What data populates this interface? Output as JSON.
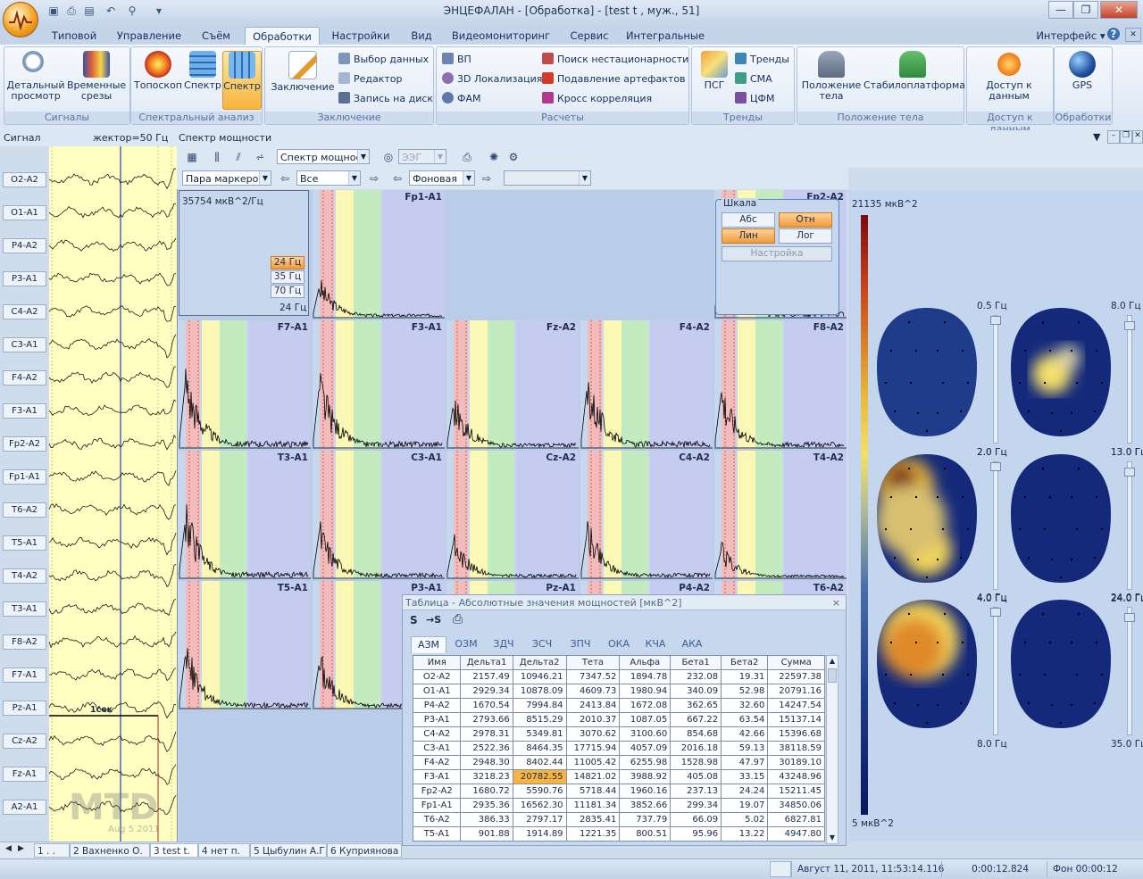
{
  "window": {
    "title": "ЭНЦЕФАЛАН - [Обработка] - [test t , муж., 51]",
    "minimize_glyph": "—",
    "maximize_glyph": "❐",
    "close_glyph": "✕"
  },
  "ribbon_tabs": [
    "Типовой",
    "Управление",
    "Съём",
    "Обработки",
    "Настройки",
    "Вид",
    "Видеомониторинг",
    "Сервис",
    "Интегральные"
  ],
  "ribbon_active_tab": "Обработки",
  "ribbon_right": {
    "interface_label": "Интерфейс",
    "help_glyph": "?"
  },
  "ribbon": {
    "signals": {
      "label": "Сигналы",
      "detail": "Детальный просмотр",
      "time_slices": "Временные срезы"
    },
    "spectral": {
      "label": "Спектральный анализ",
      "toposcop": "Топоскоп",
      "spectrum": "Спектр",
      "spectrum_active": "Спектр"
    },
    "conclusion": {
      "label": "Заключение",
      "conclusion": "Заключение",
      "select_data": "Выбор данных",
      "editor": "Редактор",
      "write_disk": "Запись на диск"
    },
    "calc": {
      "label": "Расчеты",
      "vp": "ВП",
      "loc3d": "3D Локализация",
      "fam": "ФАМ",
      "nonstat": "Поиск нестационарности",
      "artifact": "Подавление артефактов",
      "cross": "Кросс корреляция"
    },
    "trends": {
      "label": "Тренды",
      "psg": "ПСГ",
      "trends": "Тренды",
      "sma": "СМА",
      "cfm": "ЦФМ"
    },
    "body_pos": {
      "label": "Положение тела",
      "position": "Положение тела",
      "stabilo": "Стабилоплатформа"
    },
    "data_access": {
      "label": "Доступ к данным",
      "access": "Доступ к данным"
    },
    "processing": {
      "label": "Обработки",
      "gps": "GPS"
    }
  },
  "left_panel": {
    "title": "Сигнал",
    "filter": "жектор=50 Гц",
    "channels": [
      "O2-A2",
      "O1-A1",
      "P4-A2",
      "P3-A1",
      "C4-A2",
      "C3-A1",
      "F4-A2",
      "F3-A1",
      "Fp2-A2",
      "Fp1-A1",
      "T6-A2",
      "T5-A1",
      "T4-A2",
      "T3-A1",
      "F8-A2",
      "F7-A1",
      "Pz-A1",
      "Cz-A2",
      "Fz-A1",
      "A2-A1"
    ],
    "scale_label": "1сек",
    "watermark": "MTD",
    "watermark_date": "Aug  5 2011"
  },
  "spectrum_panel": {
    "title": "Спектр мощности",
    "mode_combo": "Спектр мощнос",
    "eeg_combo": "ЭЭГ",
    "marker_combo": "Пара маркеров",
    "all_combo": "Все",
    "background_combo": "Фоновая "
  },
  "spectrum_info": {
    "max_value": "35754 мкВ^2/Гц",
    "freq_options": [
      "24 Гц",
      "35 Гц",
      "70 Гц"
    ],
    "freq_selected": "24 Гц",
    "freq_bottom": "24 Гц"
  },
  "spectrum_cells": [
    {
      "name": "Fp1-A1",
      "col": 1,
      "row": 0
    },
    {
      "name": "Fp2-A2",
      "col": 4,
      "row": 0
    },
    {
      "name": "F7-A1",
      "col": 0,
      "row": 1
    },
    {
      "name": "F3-A1",
      "col": 1,
      "row": 1
    },
    {
      "name": "Fz-A2",
      "col": 2,
      "row": 1
    },
    {
      "name": "F4-A2",
      "col": 3,
      "row": 1
    },
    {
      "name": "F8-A2",
      "col": 4,
      "row": 1
    },
    {
      "name": "T3-A1",
      "col": 0,
      "row": 2
    },
    {
      "name": "C3-A1",
      "col": 1,
      "row": 2
    },
    {
      "name": "Cz-A2",
      "col": 2,
      "row": 2
    },
    {
      "name": "C4-A2",
      "col": 3,
      "row": 2
    },
    {
      "name": "T4-A2",
      "col": 4,
      "row": 2
    },
    {
      "name": "T5-A1",
      "col": 0,
      "row": 3
    },
    {
      "name": "P3-A1",
      "col": 1,
      "row": 3
    },
    {
      "name": "Pz-A1",
      "col": 2,
      "row": 3
    },
    {
      "name": "P4-A2",
      "col": 3,
      "row": 3
    },
    {
      "name": "T6-A2",
      "col": 4,
      "row": 3
    }
  ],
  "scale_box": {
    "title": "Шкала",
    "abs": "Абс",
    "rel": "Отн",
    "lin": "Лин",
    "log": "Лог",
    "active": [
      "Отн",
      "Лин"
    ],
    "settings": "Настройка"
  },
  "brain_maps": {
    "max_label": "21135 мкВ^2",
    "min_label": "5 мкВ^2",
    "maps": [
      {
        "low": "0.5 Гц",
        "high": "2.0 Гц",
        "pattern": "low"
      },
      {
        "low": "8.0 Гц",
        "high": "13.0 Гц",
        "pattern": "center"
      },
      {
        "low": "2.0 Гц",
        "high": "4.0 Гц",
        "pattern": "frontal"
      },
      {
        "low": "13.0 Гц",
        "high": "24.0 Гц",
        "pattern": "flat"
      },
      {
        "low": "4.0 Гц",
        "high": "8.0 Гц",
        "pattern": "left"
      },
      {
        "low": "24.0 Гц",
        "high": "35.0 Гц",
        "pattern": "flat"
      }
    ]
  },
  "table_window": {
    "title": "Таблица - Абсолютные значения мощностей [мкВ^2]",
    "tool_s": "S",
    "tool_arrow_s": "→S",
    "close_glyph": "×",
    "tabs": [
      "АЗМ",
      "ОЗМ",
      "ЗДЧ",
      "ЗСЧ",
      "ЗПЧ",
      "ОКА",
      "КЧА",
      "АКА"
    ],
    "active_tab": "АЗМ",
    "columns": [
      "Имя",
      "Дельта1",
      "Дельта2",
      "Тета",
      "Альфа",
      "Бета1",
      "Бета2",
      "Сумма"
    ],
    "rows": [
      [
        "O2-A2",
        "2157.49",
        "10946.21",
        "7347.52",
        "1894.78",
        "232.08",
        "19.31",
        "22597.38"
      ],
      [
        "O1-A1",
        "2929.34",
        "10878.09",
        "4609.73",
        "1980.94",
        "340.09",
        "52.98",
        "20791.16"
      ],
      [
        "P4-A2",
        "1670.54",
        "7994.84",
        "2413.84",
        "1672.08",
        "362.65",
        "32.60",
        "14247.54"
      ],
      [
        "P3-A1",
        "2793.66",
        "8515.29",
        "2010.37",
        "1087.05",
        "667.22",
        "63.54",
        "15137.14"
      ],
      [
        "C4-A2",
        "2978.31",
        "5349.81",
        "3070.62",
        "3100.60",
        "854.68",
        "42.66",
        "15396.68"
      ],
      [
        "C3-A1",
        "2522.36",
        "8464.35",
        "17715.94",
        "4057.09",
        "2016.18",
        "59.13",
        "38118.59"
      ],
      [
        "F4-A2",
        "2948.30",
        "8402.44",
        "11005.42",
        "6255.98",
        "1528.98",
        "47.97",
        "30189.10"
      ],
      [
        "F3-A1",
        "3218.23",
        "20782.55",
        "14821.02",
        "3988.92",
        "405.08",
        "33.15",
        "43248.96"
      ],
      [
        "Fp2-A2",
        "1680.72",
        "5590.76",
        "5718.44",
        "1960.16",
        "237.13",
        "24.24",
        "15211.45"
      ],
      [
        "Fp1-A1",
        "2935.36",
        "16562.30",
        "11181.34",
        "3852.66",
        "299.34",
        "19.07",
        "34850.06"
      ],
      [
        "T6-A2",
        "386.33",
        "2797.17",
        "2835.41",
        "737.79",
        "66.09",
        "5.02",
        "6827.81"
      ],
      [
        "T5-A1",
        "901.88",
        "1914.89",
        "1221.35",
        "800.51",
        "95.96",
        "13.22",
        "4947.80"
      ]
    ],
    "highlight": {
      "row": 7,
      "col": 2
    }
  },
  "patient_tabs": [
    "1  . .",
    "2 Вахненко О.",
    "3 test t.",
    "4 нет п.",
    "5 Цыбулин А.Г.",
    "6 Куприянова ("
  ],
  "status": {
    "datetime": "Август 11, 2011, 11:53:14.116",
    "elapsed": "0:00:12.824",
    "background": "Фон 00:00:12"
  },
  "colors": {
    "accent_orange": "#f6b53c",
    "band_delta": "#f2bcbc",
    "band_theta": "#fbf7b4",
    "band_alpha": "#c3ebbf",
    "band_beta": "#c6cbf0"
  }
}
